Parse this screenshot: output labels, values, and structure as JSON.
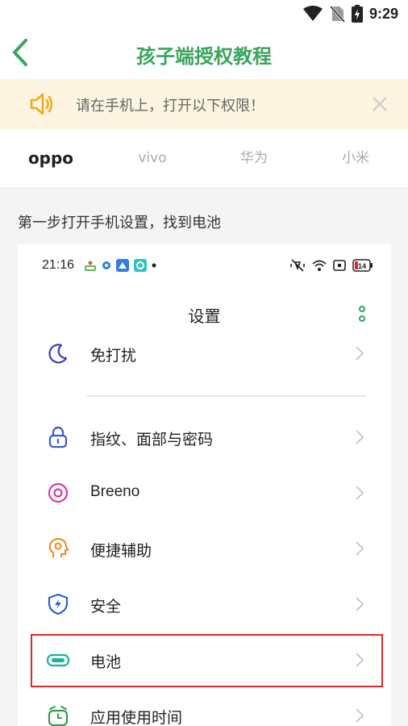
{
  "status_bar": {
    "time": "9:29",
    "icons": [
      "wifi-icon",
      "no-sim-icon",
      "battery-charging-icon"
    ]
  },
  "header": {
    "title": "孩子端授权教程",
    "back_icon": "back-arrow-icon",
    "accent": "#3aa55c"
  },
  "notice": {
    "text": "请在手机上，打开以下权限！",
    "icon": "speaker-icon",
    "close_icon": "close-icon",
    "background": "#fdf4e1"
  },
  "tabs": [
    {
      "label": "oppo",
      "active": true
    },
    {
      "label": "vivo",
      "active": false
    },
    {
      "label": "华为",
      "active": false
    },
    {
      "label": "小米",
      "active": false
    }
  ],
  "step": {
    "text": "第一步打开手机设置，找到电池"
  },
  "phone": {
    "time": "21:16",
    "battery": "14",
    "title": "设置",
    "rows": [
      {
        "label": "免打扰",
        "icon": "moon-icon"
      },
      {
        "label": "指纹、面部与密码",
        "icon": "lock-icon"
      },
      {
        "label": "Breeno",
        "icon": "breeno-icon"
      },
      {
        "label": "便捷辅助",
        "icon": "assist-head-icon"
      },
      {
        "label": "安全",
        "icon": "shield-icon"
      },
      {
        "label": "电池",
        "icon": "battery-icon",
        "highlighted": true
      },
      {
        "label": "应用使用时间",
        "icon": "app-timer-icon"
      }
    ]
  }
}
